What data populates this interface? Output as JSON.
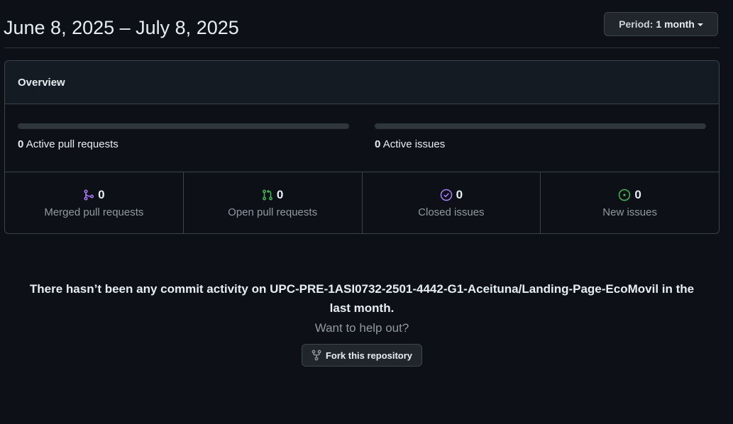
{
  "header": {
    "date_range": "June 8, 2025 – July 8, 2025",
    "period_label": "Period:",
    "period_value": "1 month"
  },
  "overview": {
    "title": "Overview",
    "pull_requests": {
      "count": "0",
      "label": "Active pull requests",
      "merged_fraction": 0
    },
    "issues": {
      "count": "0",
      "label": "Active issues",
      "closed_fraction": 0
    },
    "stats": [
      {
        "count": "0",
        "label": "Merged pull requests",
        "icon": "git-merge-icon",
        "color": "#ab7df8"
      },
      {
        "count": "0",
        "label": "Open pull requests",
        "icon": "git-pull-request-icon",
        "color": "#3fb950"
      },
      {
        "count": "0",
        "label": "Closed issues",
        "icon": "issue-closed-icon",
        "color": "#ab7df8"
      },
      {
        "count": "0",
        "label": "New issues",
        "icon": "issue-opened-icon",
        "color": "#3fb950"
      }
    ]
  },
  "empty_state": {
    "message": "There hasn’t been any commit activity on UPC-PRE-1ASI0732-2501-4442-G1-Aceituna/Landing-Page-EcoMovil in the last month.",
    "help": "Want to help out?",
    "fork_label": "Fork this repository"
  },
  "colors": {
    "background": "#0d1117",
    "border": "#3d444d",
    "muted_text": "#9198a1",
    "purple": "#ab7df8",
    "green": "#3fb950"
  }
}
